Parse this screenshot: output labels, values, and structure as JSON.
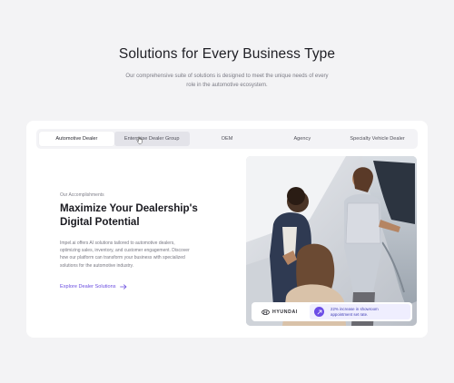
{
  "section": {
    "title": "Solutions for Every Business Type",
    "subtitle": "Our comprehensive suite of solutions is designed to meet the unique needs of every role in the automotive ecosystem."
  },
  "tabs": [
    {
      "label": "Automotive Dealer",
      "state": "active"
    },
    {
      "label": "Enterprise Dealer Group",
      "state": "hover"
    },
    {
      "label": "OEM",
      "state": "default"
    },
    {
      "label": "Agency",
      "state": "default"
    },
    {
      "label": "Specialty Vehicle Dealer",
      "state": "default"
    }
  ],
  "content": {
    "kicker": "Our Accomplishments",
    "title": "Maximize Your Dealership's Digital Potential",
    "description": "Impel.ai offers AI solutions tailored to automotive dealers, optimizing sales, inventory, and customer engagement. Discover how our platform can transform your business with specialized solutions for the automotive industry.",
    "link_label": "Explore Dealer Solutions",
    "link_icon": "arrow-right-icon"
  },
  "testimonial": {
    "brand": "HYUNDAI",
    "brand_icon": "hyundai-logo-icon",
    "stat": "22% increase in showroom appointment set rate.",
    "stat_icon": "trend-up-icon"
  },
  "colors": {
    "accent": "#6b4ce6",
    "background": "#f3f3f5",
    "card": "#ffffff"
  }
}
